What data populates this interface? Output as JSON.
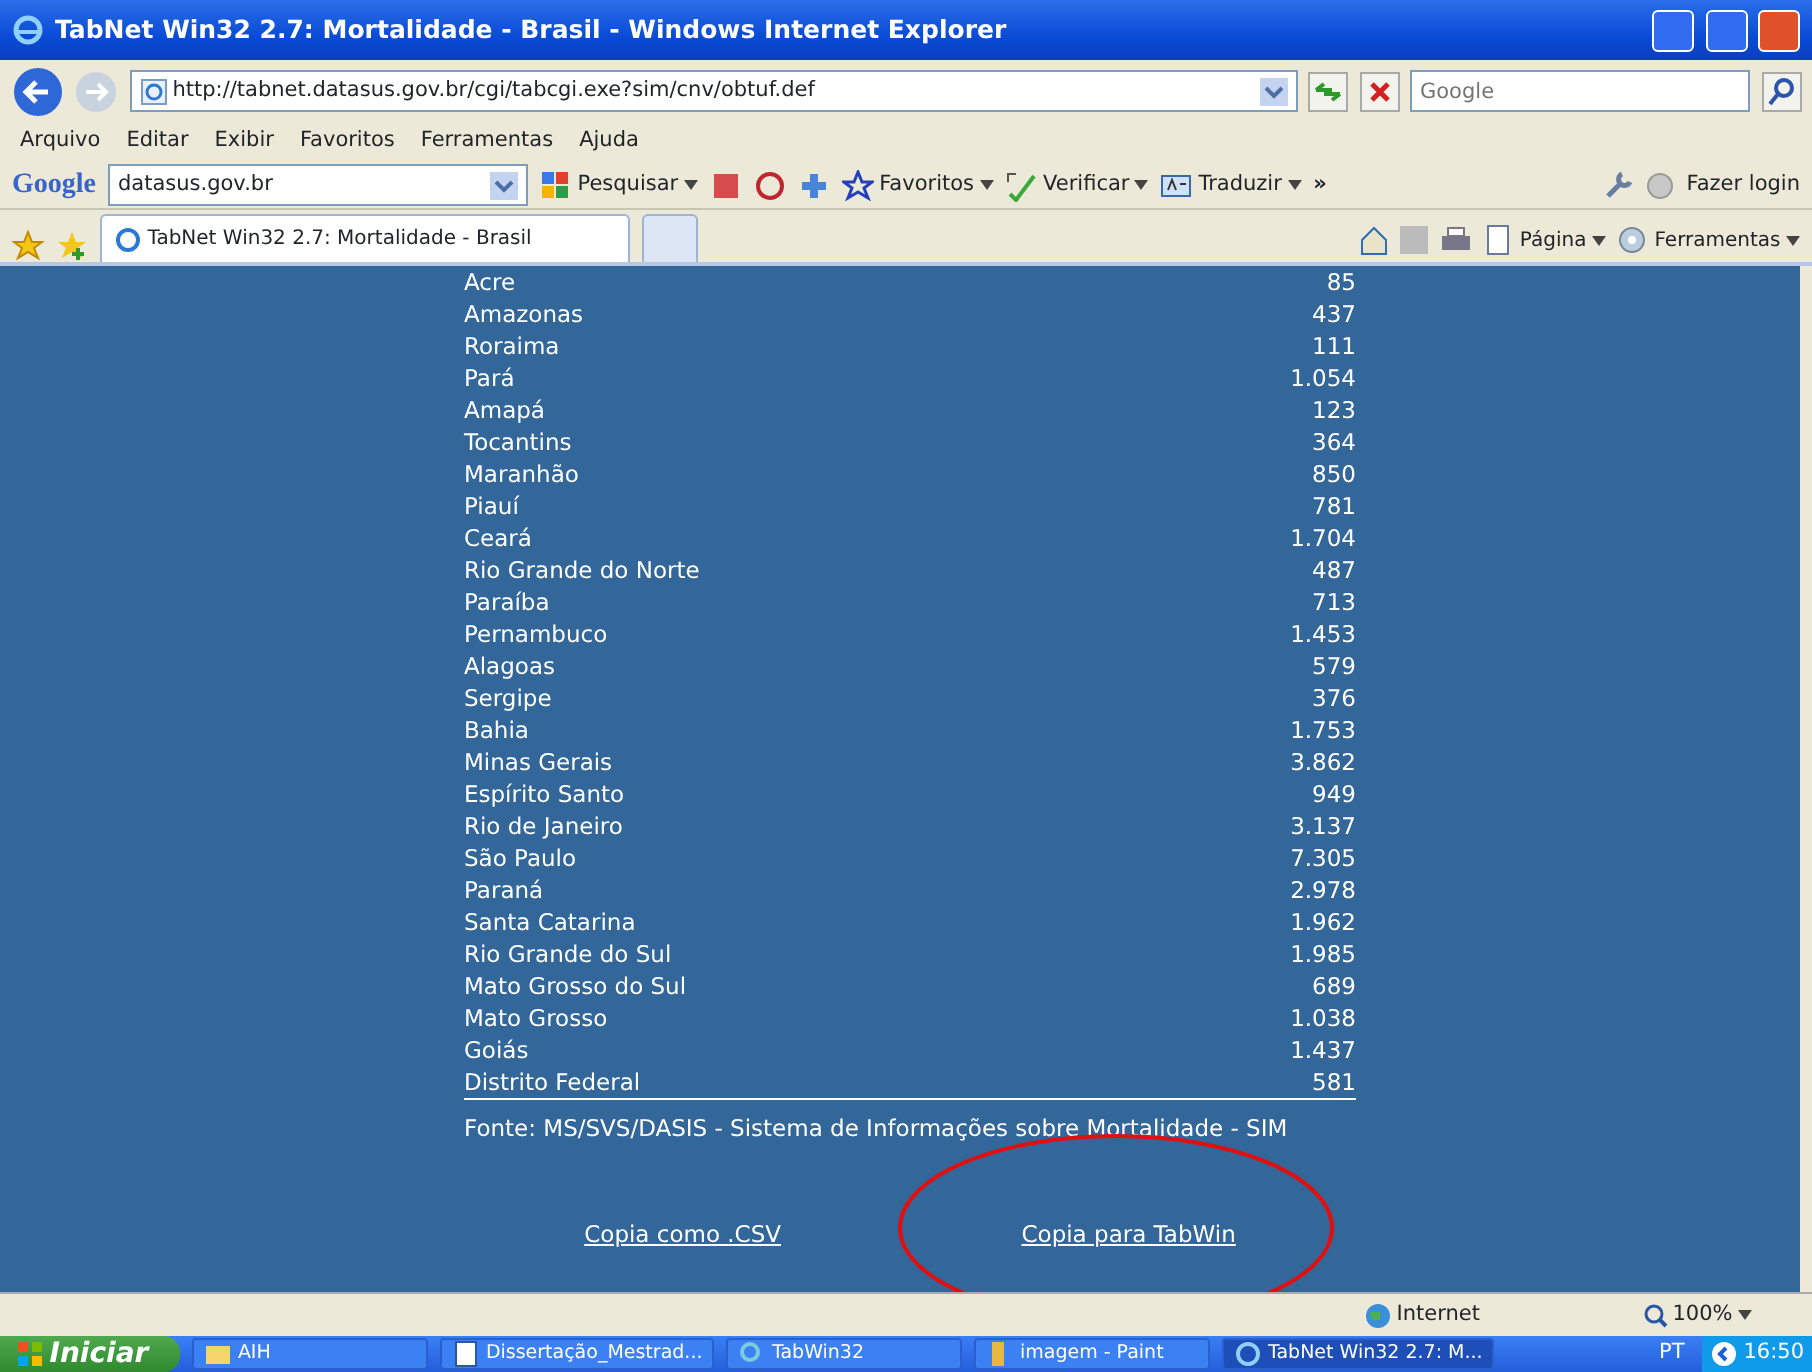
{
  "window": {
    "title": "TabNet Win32 2.7: Mortalidade - Brasil - Windows Internet Explorer"
  },
  "address_bar": {
    "url": "http://tabnet.datasus.gov.br/cgi/tabcgi.exe?sim/cnv/obtuf.def"
  },
  "search_box": {
    "placeholder": "Google"
  },
  "menu": [
    "Arquivo",
    "Editar",
    "Exibir",
    "Favoritos",
    "Ferramentas",
    "Ajuda"
  ],
  "google_toolbar": {
    "logo": "Google",
    "query": "datasus.gov.br",
    "buttons": [
      "Pesquisar",
      "Favoritos",
      "Verificar",
      "Traduzir"
    ],
    "more": "»",
    "sign_in": "Fazer login"
  },
  "tabs": [
    {
      "label": "TabNet Win32 2.7: Mortalidade - Brasil",
      "selected": true
    }
  ],
  "command_bar": [
    "Página",
    "Ferramentas"
  ],
  "table": {
    "rows": [
      {
        "state": "Acre",
        "value": "85"
      },
      {
        "state": "Amazonas",
        "value": "437"
      },
      {
        "state": "Roraima",
        "value": "111"
      },
      {
        "state": "Pará",
        "value": "1.054"
      },
      {
        "state": "Amapá",
        "value": "123"
      },
      {
        "state": "Tocantins",
        "value": "364"
      },
      {
        "state": "Maranhão",
        "value": "850"
      },
      {
        "state": "Piauí",
        "value": "781"
      },
      {
        "state": "Ceará",
        "value": "1.704"
      },
      {
        "state": "Rio Grande do Norte",
        "value": "487"
      },
      {
        "state": "Paraíba",
        "value": "713"
      },
      {
        "state": "Pernambuco",
        "value": "1.453"
      },
      {
        "state": "Alagoas",
        "value": "579"
      },
      {
        "state": "Sergipe",
        "value": "376"
      },
      {
        "state": "Bahia",
        "value": "1.753"
      },
      {
        "state": "Minas Gerais",
        "value": "3.862"
      },
      {
        "state": "Espírito Santo",
        "value": "949"
      },
      {
        "state": "Rio de Janeiro",
        "value": "3.137"
      },
      {
        "state": "São Paulo",
        "value": "7.305"
      },
      {
        "state": "Paraná",
        "value": "2.978"
      },
      {
        "state": "Santa Catarina",
        "value": "1.962"
      },
      {
        "state": "Rio Grande do Sul",
        "value": "1.985"
      },
      {
        "state": "Mato Grosso do Sul",
        "value": "689"
      },
      {
        "state": "Mato Grosso",
        "value": "1.038"
      },
      {
        "state": "Goiás",
        "value": "1.437"
      },
      {
        "state": "Distrito Federal",
        "value": "581"
      }
    ]
  },
  "source": "Fonte: MS/SVS/DASIS - Sistema de Informações sobre Mortalidade - SIM",
  "links": [
    "Copia como .CSV",
    "Copia para TabWin"
  ],
  "status_bar": {
    "zone": "Internet",
    "zoom": "100%"
  },
  "taskbar": {
    "start": "Iniciar",
    "tasks": [
      {
        "label": "AIH",
        "selected": false
      },
      {
        "label": "Dissertação_Mestrad...",
        "selected": false
      },
      {
        "label": "TabWin32",
        "selected": false
      },
      {
        "label": "imagem - Paint",
        "selected": false
      },
      {
        "label": "TabNet Win32 2.7: M...",
        "selected": true
      }
    ],
    "language": "PT",
    "clock": "16:50"
  }
}
